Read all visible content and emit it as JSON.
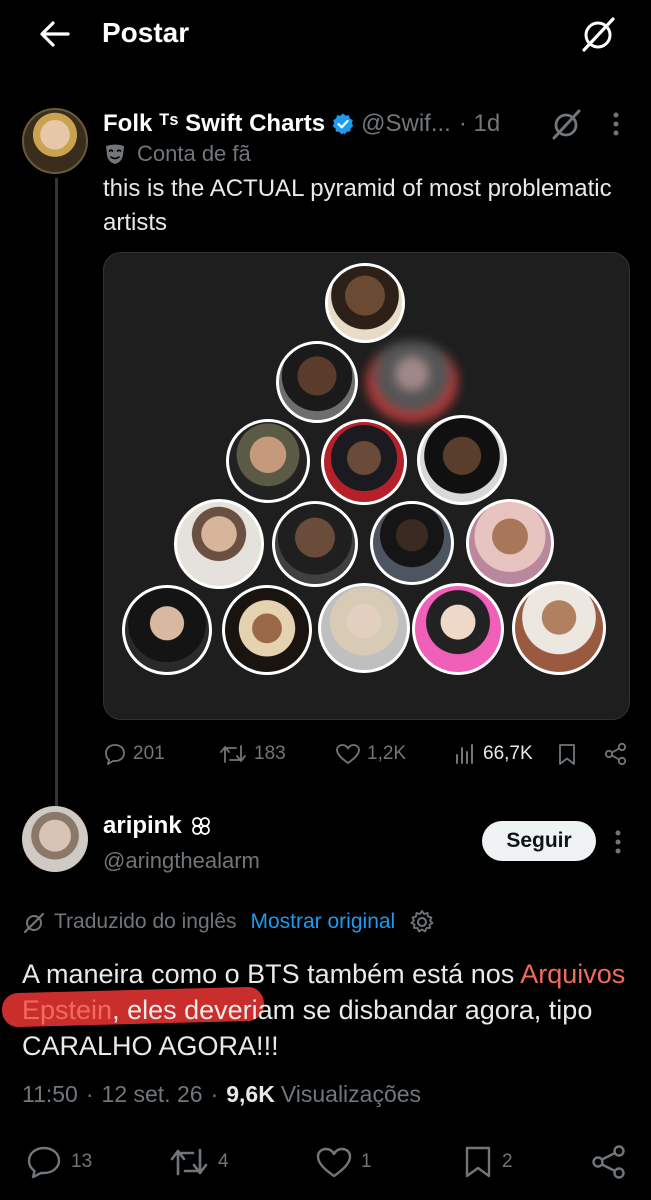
{
  "header": {
    "title": "Postar"
  },
  "original_post": {
    "display_name": "Folk ᵀˢ Swift Charts",
    "handle": "@Swif...",
    "time": "· 1d",
    "fan_label": "Conta de fã",
    "text": "this is the ACTUAL pyramid of most problematic artists",
    "stats": {
      "replies": "201",
      "reposts": "183",
      "likes": "1,2K",
      "views": "66,7K"
    }
  },
  "reply_post": {
    "display_name": "aripink",
    "handle": "@aringthealarm",
    "follow_label": "Seguir",
    "translated_label": "Traduzido do inglês",
    "show_original_label": "Mostrar original",
    "text_before": "A maneira como o BTS também está nos ",
    "text_highlight": "Arquivos Epstein",
    "text_after": ", eles deveriam se disbandar agora, tipo CARALHO AGORA!!!",
    "time": "11:50",
    "date": "12 set. 26",
    "views_count": "9,6K",
    "views_label": "Visualizações",
    "stats": {
      "replies": "13",
      "reposts": "4",
      "likes": "1",
      "bookmarks": "2"
    }
  },
  "colors": {
    "background": "#000000",
    "accent_link": "#1d9bf0",
    "verified": "#1d9bf0",
    "muted": "#71767b",
    "highlight_marker": "#d9322f"
  }
}
